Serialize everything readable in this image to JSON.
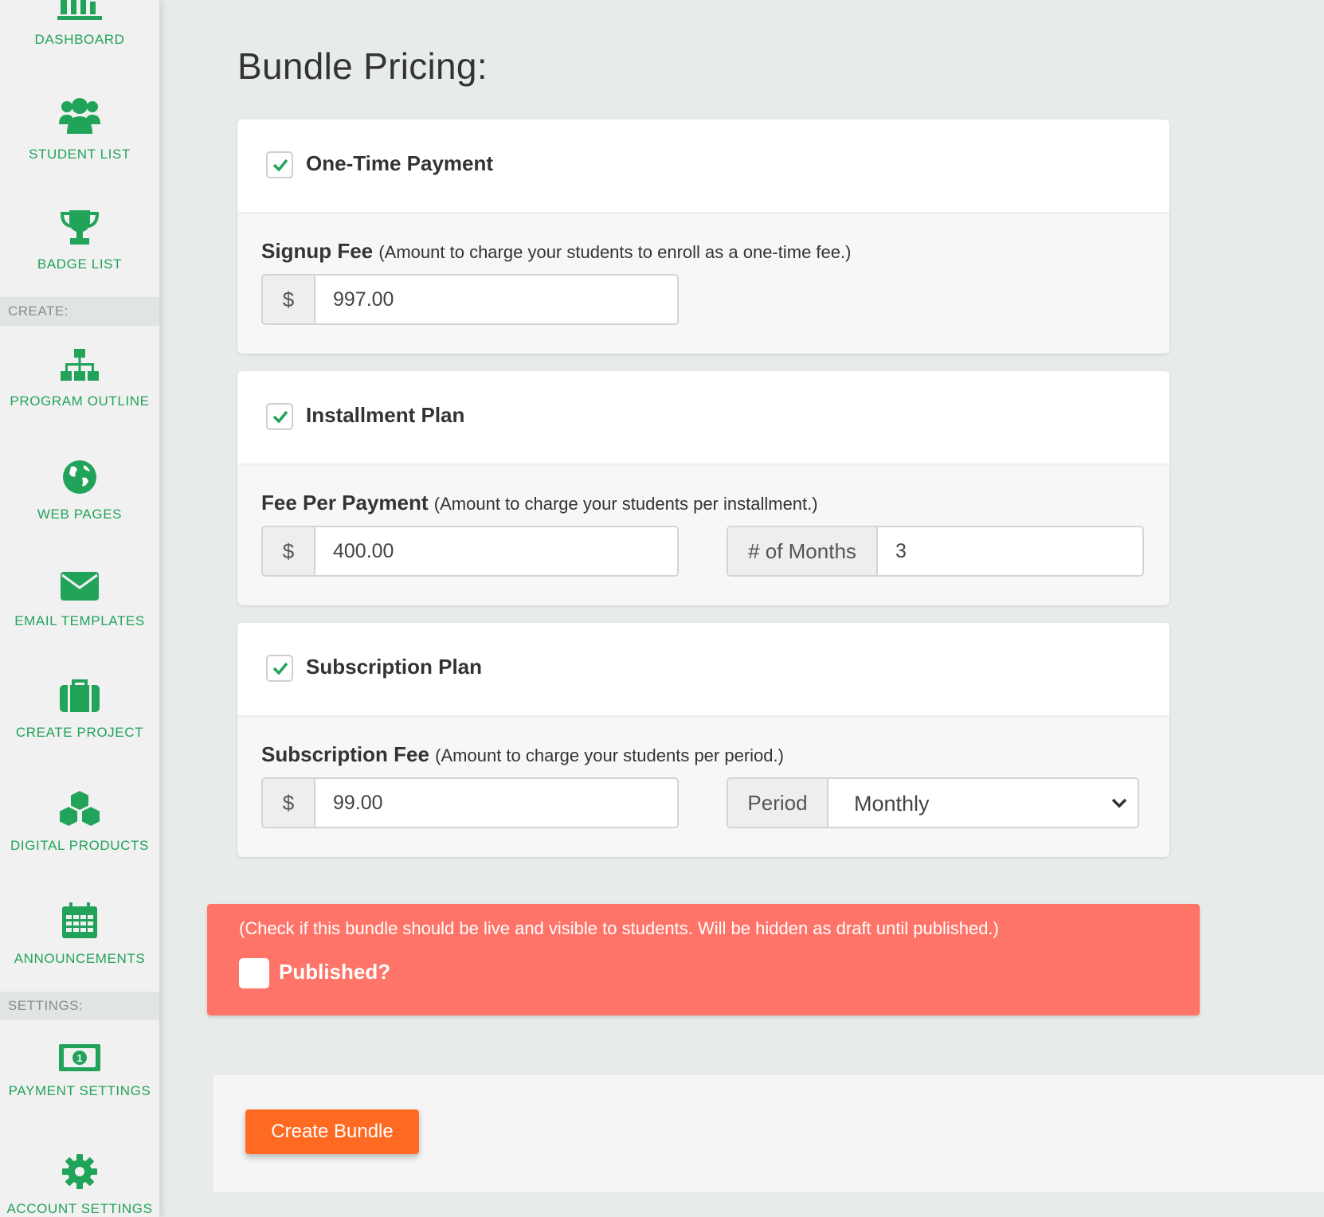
{
  "sidebar": {
    "items": [
      {
        "label": "DASHBOARD",
        "icon": "bar-chart-icon"
      },
      {
        "label": "STUDENT LIST",
        "icon": "users-icon"
      },
      {
        "label": "BADGE LIST",
        "icon": "trophy-icon"
      },
      {
        "label": "PROGRAM OUTLINE",
        "icon": "sitemap-icon"
      },
      {
        "label": "WEB PAGES",
        "icon": "globe-icon"
      },
      {
        "label": "EMAIL TEMPLATES",
        "icon": "envelope-icon"
      },
      {
        "label": "CREATE PROJECT",
        "icon": "briefcase-icon"
      },
      {
        "label": "DIGITAL PRODUCTS",
        "icon": "cubes-icon"
      },
      {
        "label": "ANNOUNCEMENTS",
        "icon": "calendar-icon"
      },
      {
        "label": "PAYMENT SETTINGS",
        "icon": "money-icon"
      },
      {
        "label": "ACCOUNT SETTINGS",
        "icon": "gear-icon"
      }
    ],
    "sections": {
      "create": "CREATE:",
      "settings": "SETTINGS:"
    }
  },
  "main": {
    "title": "Bundle Pricing:",
    "one_time": {
      "checked": true,
      "title": "One-Time Payment",
      "label": "Signup Fee",
      "hint": "(Amount to charge your students to enroll as a one-time fee.)",
      "currency": "$",
      "value": "997.00"
    },
    "installment": {
      "checked": true,
      "title": "Installment Plan",
      "label": "Fee Per Payment",
      "hint": "(Amount to charge your students per installment.)",
      "currency": "$",
      "value": "400.00",
      "months_label": "# of Months",
      "months_value": "3"
    },
    "subscription": {
      "checked": true,
      "title": "Subscription Plan",
      "label": "Subscription Fee",
      "hint": "(Amount to charge your students per period.)",
      "currency": "$",
      "value": "99.00",
      "period_label": "Period",
      "period_value": "Monthly"
    },
    "publish": {
      "hint": "(Check if this bundle should be live and visible to students. Will be hidden as draft until published.)",
      "label": "Published?",
      "checked": false
    },
    "create_button": "Create Bundle"
  },
  "colors": {
    "accent_green": "#21a35a",
    "alert_red": "#ff7468",
    "button_orange": "#ff6a23"
  }
}
